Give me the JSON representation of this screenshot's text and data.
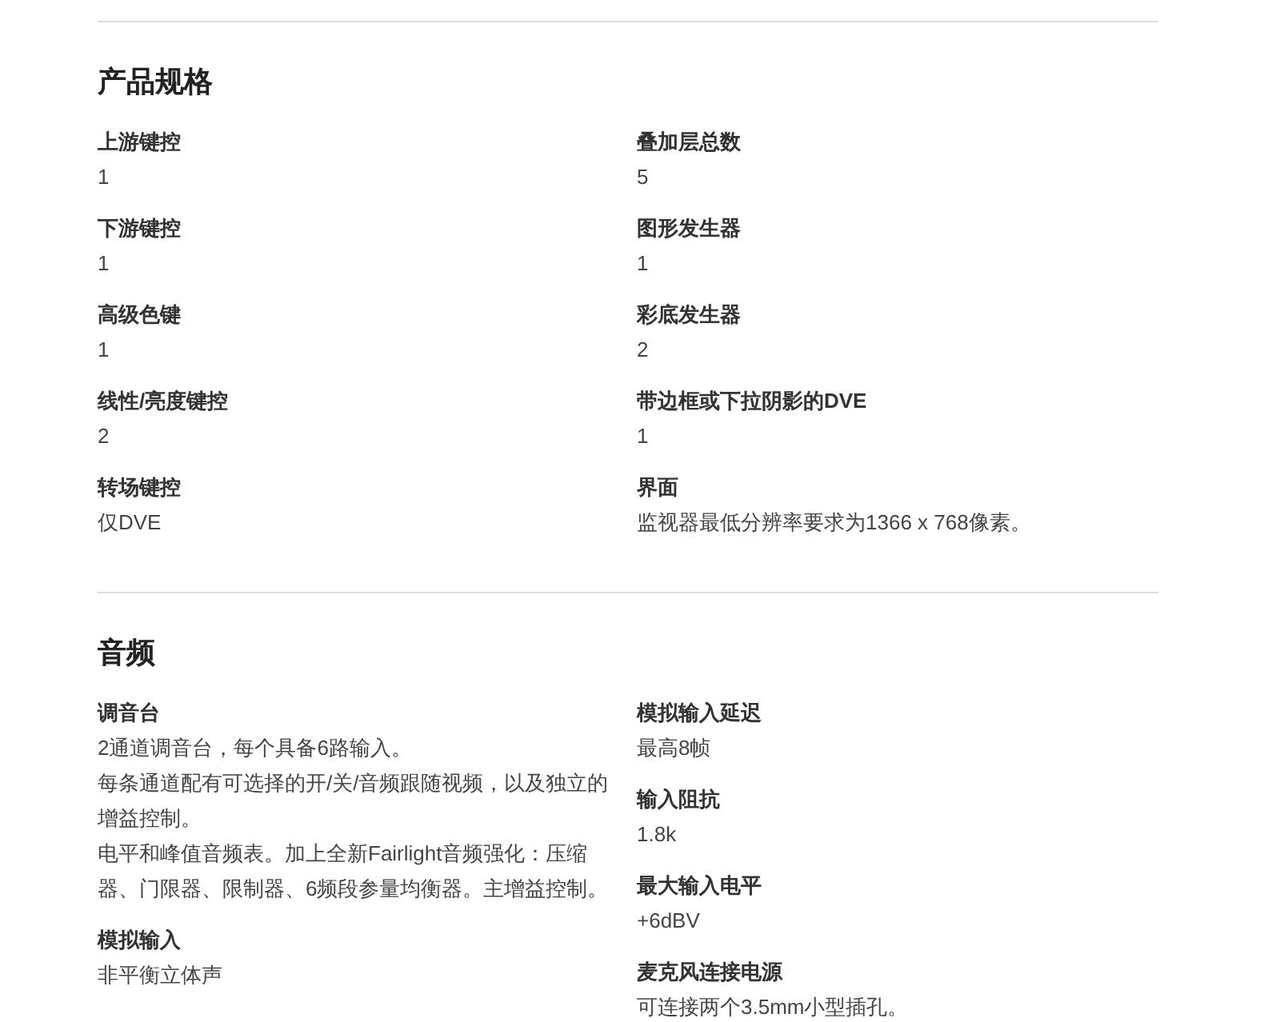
{
  "sections": [
    {
      "title": "产品规格",
      "columns": [
        [
          {
            "label": "上游键控",
            "values": [
              "1"
            ]
          },
          {
            "label": "下游键控",
            "values": [
              "1"
            ]
          },
          {
            "label": "高级色键",
            "values": [
              "1"
            ]
          },
          {
            "label": "线性/亮度键控",
            "values": [
              "2"
            ]
          },
          {
            "label": "转场键控",
            "values": [
              "仅DVE"
            ]
          }
        ],
        [
          {
            "label": "叠加层总数",
            "values": [
              "5"
            ]
          },
          {
            "label": "图形发生器",
            "values": [
              "1"
            ]
          },
          {
            "label": "彩底发生器",
            "values": [
              "2"
            ]
          },
          {
            "label": "带边框或下拉阴影的DVE",
            "values": [
              "1"
            ]
          },
          {
            "label": "界面",
            "values": [
              "监视器最低分辨率要求为1366 x 768像素。"
            ]
          }
        ]
      ]
    },
    {
      "title": "音频",
      "columns": [
        [
          {
            "label": "调音台",
            "values": [
              "2通道调音台，每个具备6路输入。",
              "每条通道配有可选择的开/关/音频跟随视频，以及独立的增益控制。",
              "电平和峰值音频表。加上全新Fairlight音频强化：压缩器、门限器、限制器、6频段参量均衡器。主增益控制。"
            ]
          },
          {
            "label": "模拟输入",
            "values": [
              "非平衡立体声"
            ]
          }
        ],
        [
          {
            "label": "模拟输入延迟",
            "values": [
              "最高8帧"
            ]
          },
          {
            "label": "输入阻抗",
            "values": [
              "1.8k"
            ]
          },
          {
            "label": "最大输入电平",
            "values": [
              "+6dBV"
            ]
          },
          {
            "label": "麦克风连接电源",
            "values": [
              "可连接两个3.5mm小型插孔。"
            ]
          }
        ]
      ]
    }
  ]
}
